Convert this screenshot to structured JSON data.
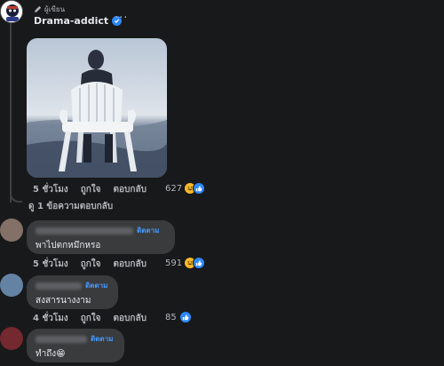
{
  "post": {
    "author_badge": "ผู้เขียน",
    "author_name": "Drama-addict",
    "more": "···",
    "time": "5 ชั่วโมง",
    "like": "ถูกใจ",
    "reply": "ตอบกลับ",
    "reaction_count": "627"
  },
  "view_replies": "ดู 1 ข้อความตอบกลับ",
  "comments": [
    {
      "follow": "ติดตาม",
      "text": "พาไปตกหมึกหรอ",
      "time": "5 ชั่วโมง",
      "like": "ถูกใจ",
      "reply": "ตอบกลับ",
      "reaction_count": "591"
    },
    {
      "follow": "ติดตาม",
      "text": "สงสารนางงาม",
      "time": "4 ชั่วโมง",
      "like": "ถูกใจ",
      "reply": "ตอบกลับ",
      "reaction_count": "85"
    },
    {
      "follow": "ติดตาม",
      "text": "ทำถึง😁"
    }
  ],
  "colors": {
    "background": "#18191a",
    "bubble": "#3a3b3c",
    "link": "#4599ff",
    "like_blue": "#2d88ff",
    "haha_yellow": "#f7b928"
  }
}
